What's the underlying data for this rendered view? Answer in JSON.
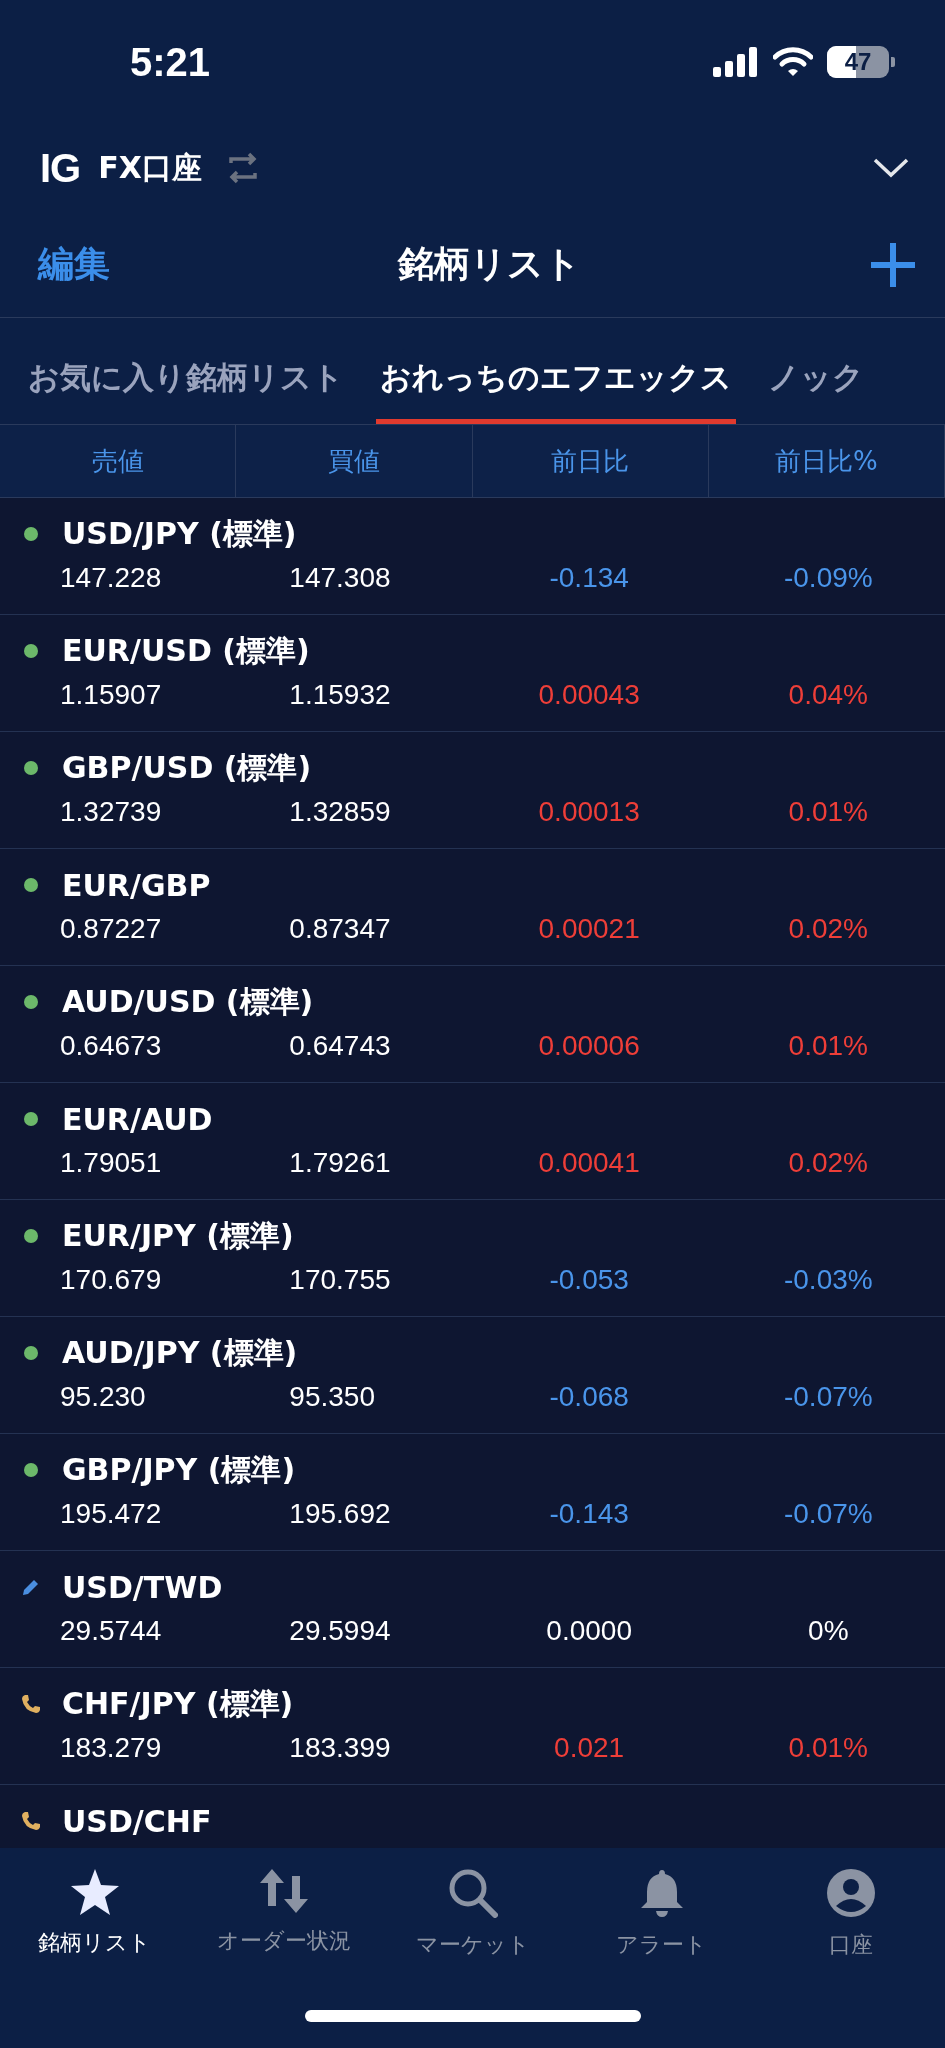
{
  "status_bar": {
    "time": "5:21",
    "battery": "47"
  },
  "account": {
    "logo": "IG",
    "name": "FX口座"
  },
  "nav": {
    "edit": "編集",
    "title": "銘柄リスト"
  },
  "tabs": [
    {
      "label": "お気に入り銘柄リスト",
      "selected": false
    },
    {
      "label": "おれっちのエフエックス",
      "selected": true
    },
    {
      "label": "ノック",
      "selected": false
    }
  ],
  "columns": [
    "売値",
    "買値",
    "前日比",
    "前日比%"
  ],
  "rows": [
    {
      "kind": "open",
      "name": "USD/JPY (標準)",
      "sell": "147.228",
      "buy": "147.308",
      "change": "-0.134",
      "change_pct": "-0.09%",
      "color": "#4a95ea"
    },
    {
      "kind": "open",
      "name": "EUR/USD (標準)",
      "sell": "1.15907",
      "buy": "1.15932",
      "change": "0.00043",
      "change_pct": "0.04%",
      "color": "#ee3e38"
    },
    {
      "kind": "open",
      "name": "GBP/USD (標準)",
      "sell": "1.32739",
      "buy": "1.32859",
      "change": "0.00013",
      "change_pct": "0.01%",
      "color": "#ee3e38"
    },
    {
      "kind": "open",
      "name": "EUR/GBP",
      "sell": "0.87227",
      "buy": "0.87347",
      "change": "0.00021",
      "change_pct": "0.02%",
      "color": "#ee3e38"
    },
    {
      "kind": "open",
      "name": "AUD/USD (標準)",
      "sell": "0.64673",
      "buy": "0.64743",
      "change": "0.00006",
      "change_pct": "0.01%",
      "color": "#ee3e38"
    },
    {
      "kind": "open",
      "name": "EUR/AUD",
      "sell": "1.79051",
      "buy": "1.79261",
      "change": "0.00041",
      "change_pct": "0.02%",
      "color": "#ee3e38"
    },
    {
      "kind": "open",
      "name": "EUR/JPY (標準)",
      "sell": "170.679",
      "buy": "170.755",
      "change": "-0.053",
      "change_pct": "-0.03%",
      "color": "#4a95ea"
    },
    {
      "kind": "open",
      "name": "AUD/JPY (標準)",
      "sell": "95.230",
      "buy": "95.350",
      "change": "-0.068",
      "change_pct": "-0.07%",
      "color": "#4a95ea"
    },
    {
      "kind": "open",
      "name": "GBP/JPY (標準)",
      "sell": "195.472",
      "buy": "195.692",
      "change": "-0.143",
      "change_pct": "-0.07%",
      "color": "#4a95ea"
    },
    {
      "kind": "edit",
      "name": "USD/TWD",
      "sell": "29.5744",
      "buy": "29.5994",
      "change": "0.0000",
      "change_pct": "0%",
      "color": "#ffffff"
    },
    {
      "kind": "phone",
      "name": "CHF/JPY (標準)",
      "sell": "183.279",
      "buy": "183.399",
      "change": "0.021",
      "change_pct": "0.01%",
      "color": "#ee3e38"
    },
    {
      "kind": "phone",
      "name": "USD/CHF"
    }
  ],
  "bottom_nav": [
    {
      "kind": "star",
      "label": "銘柄リスト",
      "selected": true
    },
    {
      "kind": "arrows",
      "label": "オーダー状況",
      "selected": false
    },
    {
      "kind": "search",
      "label": "マーケット",
      "selected": false
    },
    {
      "kind": "bell",
      "label": "アラート",
      "selected": false
    },
    {
      "kind": "account",
      "label": "口座",
      "selected": false
    }
  ]
}
